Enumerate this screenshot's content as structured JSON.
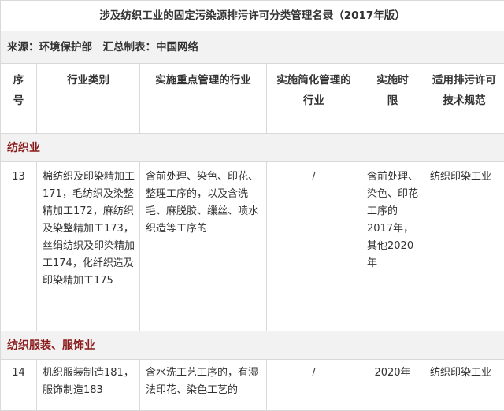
{
  "title": "涉及纺织工业的固定污染源排污许可分类管理名录（2017年版）",
  "source": "来源：环境保护部　汇总制表：中国网络",
  "headers": {
    "no": "序号",
    "category": "行业类别",
    "key": "实施重点管理的行业",
    "simple": "实施简化管理的行业",
    "time": "实施时限",
    "spec": "适用排污许可技术规范"
  },
  "sections": [
    {
      "name": "纺织业",
      "row": {
        "no": "13",
        "category": "棉纺织及印染精加工171，毛纺织及染整精加工172，麻纺织及染整精加工173，丝绢纺织及印染精加工174，化纤织造及印染精加工175",
        "key": "含前处理、染色、印花、整理工序的，以及含洗毛、麻脱胶、缫丝、喷水织造等工序的",
        "simple": "/",
        "time": "含前处理、染色、印花工序的2017年，其他2020年",
        "spec": "纺织印染工业"
      }
    },
    {
      "name": "纺织服装、服饰业",
      "row": {
        "no": "14",
        "category": "机织服装制造181，服饰制造183",
        "key": "含水洗工艺工序的，有湿法印花、染色工艺的",
        "simple": "/",
        "time": "2020年",
        "spec": "纺织印染工业"
      }
    }
  ]
}
